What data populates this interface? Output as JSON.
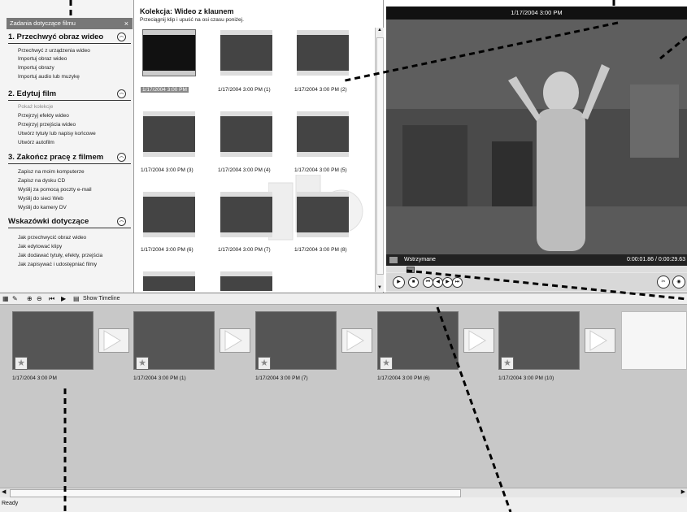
{
  "tasks_pane": {
    "header": "Zadania dotyczące filmu",
    "close_label": "×",
    "sections": [
      {
        "title": "1. Przechwyć obraz wideo",
        "items": [
          "Przechwyć z urządzenia wideo",
          "Importuj obraz wideo",
          "Importuj obrazy",
          "Importuj audio lub muzykę"
        ]
      },
      {
        "title": "2. Edytuj film",
        "items": [
          "Pokaż kolekcje",
          "Przejrzyj efekty wideo",
          "Przejrzyj przejścia wideo",
          "Utwórz tytuły lub napisy końcowe",
          "Utwórz autofilm"
        ]
      },
      {
        "title": "3. Zakończ pracę z filmem",
        "items": [
          "Zapisz na moim komputerze",
          "Zapisz na dysku CD",
          "Wyślij za pomocą poczty e-mail",
          "Wyślij do sieci Web",
          "Wyślij do kamery DV"
        ]
      },
      {
        "title": "Wskazówki dotyczące",
        "items": [
          "Jak przechwycić obraz wideo",
          "Jak edytować klipy",
          "Jak dodawać tytuły, efekty, przejścia",
          "Jak zapisywać i udostępniać filmy"
        ]
      }
    ]
  },
  "collection": {
    "title": "Kolekcja: Wideo z klaunem",
    "subtitle": "Przeciągnij klip i upuść na osi czasu poniżej.",
    "clips": [
      "1/17/2004 3:00 PM",
      "1/17/2004 3:00 PM (1)",
      "1/17/2004 3:00 PM (2)",
      "1/17/2004 3:00 PM (3)",
      "1/17/2004 3:00 PM (4)",
      "1/17/2004 3:00 PM (5)",
      "1/17/2004 3:00 PM (6)",
      "1/17/2004 3:00 PM (7)",
      "1/17/2004 3:00 PM (8)"
    ]
  },
  "preview": {
    "title": "1/17/2004 3:00 PM",
    "status": "Wstrzymane",
    "time": "0:00:01.86 / 0:00:29.63"
  },
  "storyboard_toolbar": {
    "show_timeline": "Show Timeline"
  },
  "storyboard": {
    "clips": [
      "1/17/2004 3:00 PM",
      "1/17/2004 3:00 PM (1)",
      "1/17/2004 3:00 PM (7)",
      "1/17/2004 3:00 PM (6)",
      "1/17/2004 3:00 PM (10)"
    ]
  },
  "status_line": "Ready",
  "colors": {
    "pane_bg": "#f4f4f4",
    "storyboard_bg": "#c8c8c8",
    "selection": "#888888",
    "player_bar": "#222222"
  }
}
